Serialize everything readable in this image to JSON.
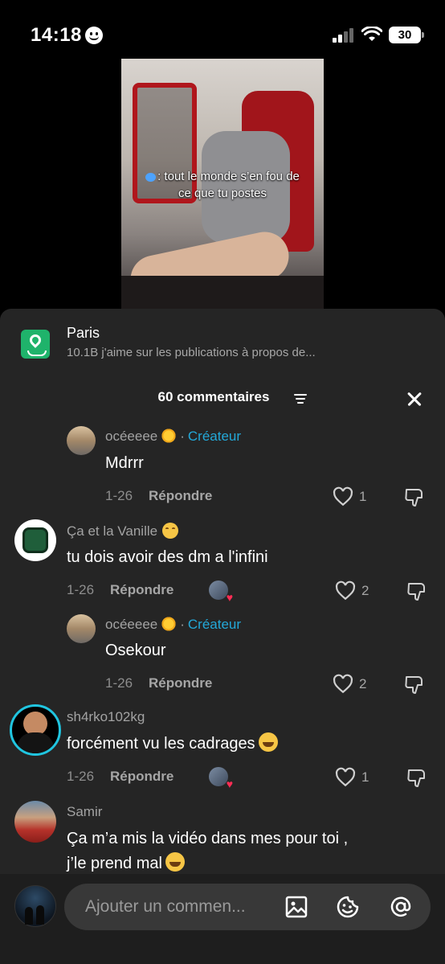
{
  "status_bar": {
    "time": "14:18",
    "battery": "30"
  },
  "video": {
    "caption_line1": ": tout le monde s’en fou de",
    "caption_line2": "ce que tu postes"
  },
  "place": {
    "name": "Paris",
    "subtitle": "10.1B j'aime sur les publications à propos de..."
  },
  "comments_header": {
    "count_label": "60 commentaires"
  },
  "comments": [
    {
      "user": "océeeee",
      "creator_label": "Créateur",
      "text": "Mdrrr",
      "date": "1-26",
      "reply_label": "Répondre",
      "likes": "1"
    },
    {
      "user": "Ça et la Vanille",
      "text": "tu dois avoir des dm a l'infini",
      "date": "1-26",
      "reply_label": "Répondre",
      "likes": "2"
    },
    {
      "user": "océeeee",
      "creator_label": "Créateur",
      "text": "Osekour",
      "date": "1-26",
      "reply_label": "Répondre",
      "likes": "2"
    },
    {
      "user": "sh4rko102kg",
      "text": "forcément vu les cadrages",
      "date": "1-26",
      "reply_label": "Répondre",
      "likes": "1"
    },
    {
      "user": "Samir",
      "text_line1": "Ça m’a mis la vidéo dans mes pour toi ,",
      "text_line2": "j’le prend mal"
    }
  ],
  "input": {
    "placeholder": "Ajouter un commen..."
  },
  "icons": [
    "location-pin-icon",
    "filter-icon",
    "close-icon",
    "heart-icon",
    "dislike-icon",
    "image-icon",
    "emoji-icon",
    "at-icon"
  ],
  "colors": {
    "sheet_bg": "#252525",
    "creator": "#23a8d8",
    "place_icon": "#1fb36b",
    "liked_heart": "#ff2d55"
  }
}
